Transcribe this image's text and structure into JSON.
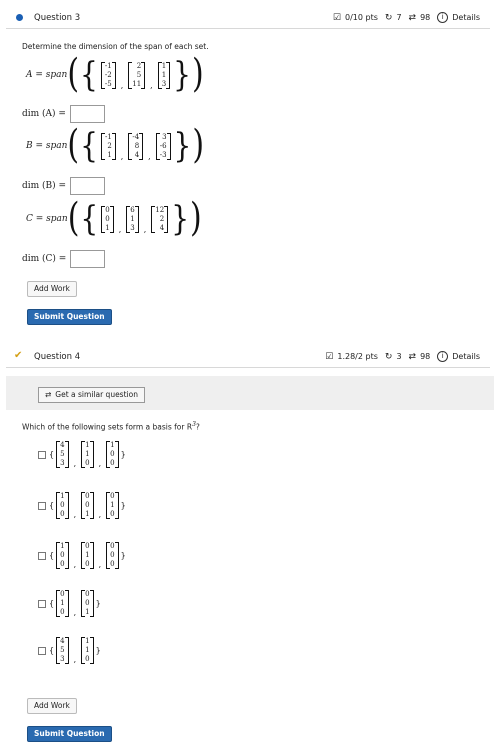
{
  "q3": {
    "title": "Question 3",
    "pts": "0/10 pts",
    "retries": "7",
    "attempts": "98",
    "details": "Details",
    "prompt": "Determine the dimension of the span of each set.",
    "A": {
      "label": "A = span",
      "vectors": [
        [
          "-1",
          "-2",
          "-5"
        ],
        [
          "2",
          "5",
          "11"
        ],
        [
          "1",
          "1",
          "3"
        ]
      ],
      "dim_label": "dim (A) ="
    },
    "B": {
      "label": "B = span",
      "vectors": [
        [
          "-1",
          "2",
          "1"
        ],
        [
          "-4",
          "8",
          "4"
        ],
        [
          "3",
          "-6",
          "-3"
        ]
      ],
      "dim_label": "dim (B) ="
    },
    "C": {
      "label": "C = span",
      "vectors": [
        [
          "0",
          "0",
          "1"
        ],
        [
          "6",
          "1",
          "3"
        ],
        [
          "12",
          "2",
          "4"
        ]
      ],
      "dim_label": "dim (C) ="
    },
    "add_work": "Add Work",
    "submit": "Submit Question"
  },
  "q4": {
    "title": "Question 4",
    "pts": "1.28/2 pts",
    "retries": "3",
    "attempts": "98",
    "details": "Details",
    "similar": "Get a similar question",
    "prompt": "Which of the following sets form a basis for R",
    "prompt_sup": "3",
    "prompt_end": "?",
    "options": [
      [
        [
          "4",
          "5",
          "3"
        ],
        [
          "1",
          "1",
          "0"
        ],
        [
          "1",
          "0",
          "0"
        ]
      ],
      [
        [
          "1",
          "0",
          "0"
        ],
        [
          "0",
          "0",
          "1"
        ],
        [
          "0",
          "1",
          "0"
        ]
      ],
      [
        [
          "1",
          "0",
          "0"
        ],
        [
          "0",
          "1",
          "0"
        ],
        [
          "0",
          "0",
          "0"
        ]
      ],
      [
        [
          "0",
          "1",
          "0"
        ],
        [
          "0",
          "0",
          "1"
        ]
      ],
      [
        [
          "4",
          "5",
          "3"
        ],
        [
          "1",
          "1",
          "0"
        ]
      ]
    ],
    "add_work": "Add Work",
    "submit": "Submit Question"
  },
  "colors": {
    "accent": "#2a6ab0",
    "bullet": "#1a5fb4",
    "check": "#d4a017"
  }
}
